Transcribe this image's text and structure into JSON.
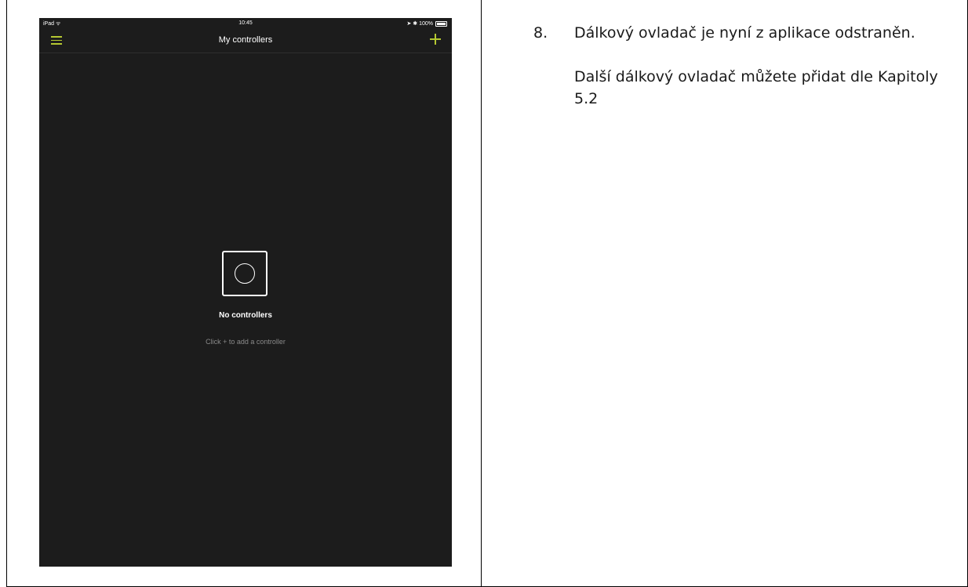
{
  "ipad": {
    "statusbar": {
      "left": "iPad ᯤ",
      "time": "10:45",
      "right": "➤ ✱ 100%",
      "battery_level": 1.0
    },
    "navbar": {
      "title": "My controllers",
      "menu_icon": "hamburger-menu-icon",
      "add_icon": "plus-icon",
      "accent_color": "#b5c832"
    },
    "empty_state": {
      "icon": "controller-icon",
      "title": "No controllers",
      "subtitle": "Click + to add a controller"
    },
    "background_color": "#1c1c1c"
  },
  "instructions": {
    "step_number": "8.",
    "step_text": "Dálkový ovladač je nyní z aplikace odstraněn.",
    "followup": "Další dálkový ovladač můžete přidat dle Kapitoly 5.2"
  }
}
